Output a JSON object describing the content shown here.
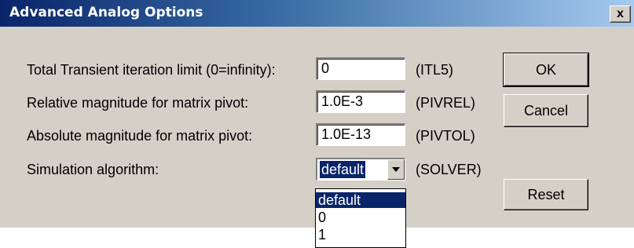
{
  "window": {
    "title": "Advanced Analog Options",
    "close_glyph": "x",
    "close_icon": "close-icon"
  },
  "rows": [
    {
      "label": "Total Transient iteration limit (0=infinity):",
      "value": "0",
      "param": "(ITL5)"
    },
    {
      "label": "Relative magnitude for matrix pivot:",
      "value": "1.0E-3",
      "param": "(PIVREL)"
    },
    {
      "label": "Absolute magnitude for matrix pivot:",
      "value": "1.0E-13",
      "param": "(PIVTOL)"
    },
    {
      "label": "Simulation algorithm:",
      "value": "default",
      "param": "(SOLVER)"
    }
  ],
  "dropdown": {
    "selected": "default",
    "options": [
      "default",
      "0",
      "1"
    ],
    "arrow_icon": "chevron-down-icon"
  },
  "buttons": {
    "ok": "OK",
    "cancel": "Cancel",
    "reset": "Reset"
  },
  "colors": {
    "title_gradient_start": "#0a246a",
    "title_gradient_end": "#a6caf0",
    "dialog_face": "#d4d0c8",
    "selection": "#0a246a"
  }
}
